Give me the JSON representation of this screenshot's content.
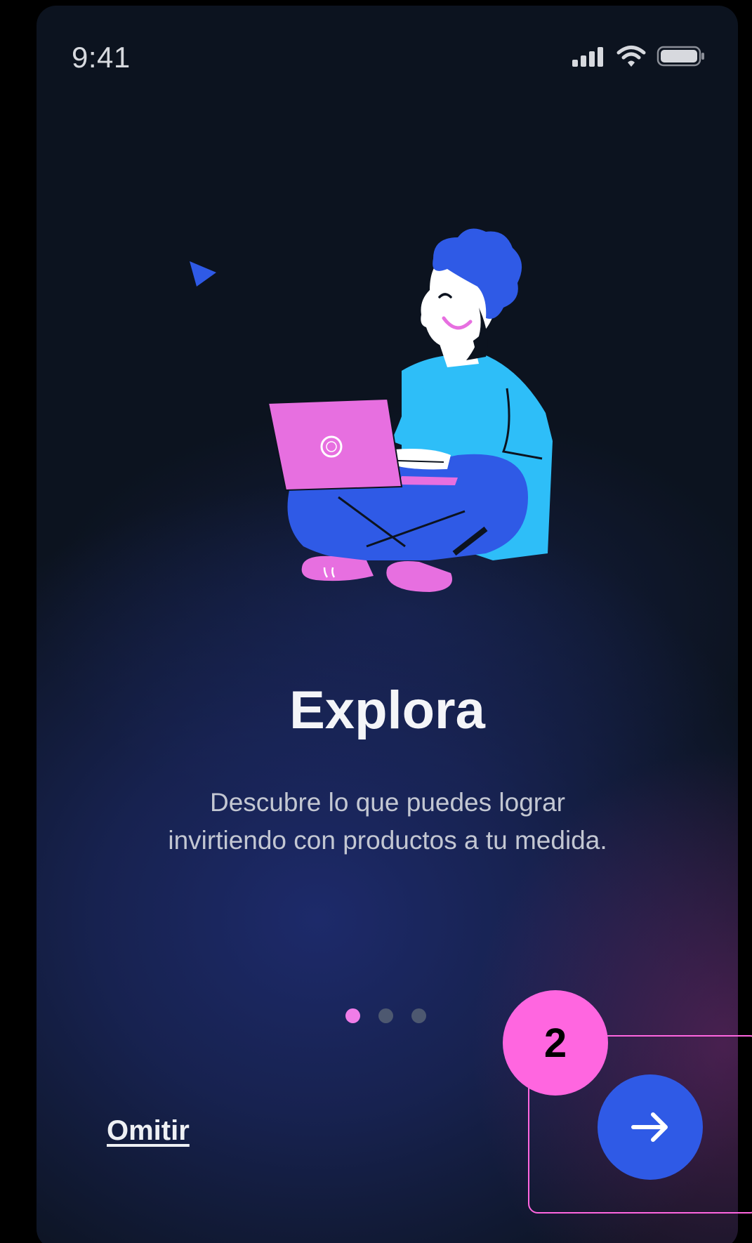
{
  "status_bar": {
    "time": "9:41",
    "icons": [
      "signal-bars-icon",
      "wifi-icon",
      "battery-icon"
    ]
  },
  "onboarding": {
    "illustration": "person-with-laptop-illustration",
    "title": "Explora",
    "subtitle_line1": "Descubre lo que puedes lograr",
    "subtitle_line2": "invirtiendo con productos a tu medida.",
    "pagination": {
      "total": 3,
      "active_index": 0
    },
    "skip_label": "Omitir",
    "next_icon": "arrow-right-icon"
  },
  "annotation": {
    "badge_label": "2"
  },
  "colors": {
    "background": "#0c131f",
    "accent_blue": "#2f5ae6",
    "accent_pink": "#e76fe0",
    "annotation_pink": "#ff66e0",
    "shirt_blue": "#2ebef8"
  }
}
